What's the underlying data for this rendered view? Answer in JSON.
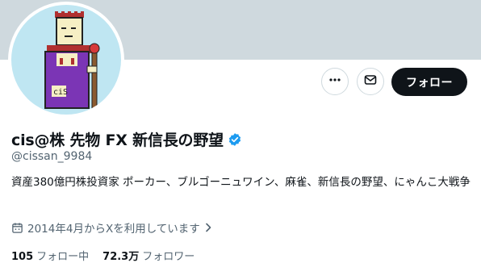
{
  "profile": {
    "display_name": "cis@株 先物 FX 新信長の野望",
    "handle": "@cissan_9984",
    "bio": "資産380億円株投資家 ポーカー、ブルゴーニュワイン、麻雀、新信長の野望、にゃんこ大戦争",
    "joined": "2014年4月からXを利用しています",
    "avatar_text": "ciS",
    "verified_icon": "verified-badge-icon"
  },
  "actions": {
    "more_icon": "more-icon",
    "message_icon": "mail-icon",
    "follow_label": "フォロー"
  },
  "stats": {
    "following_count": "105",
    "following_label": "フォロー中",
    "followers_count": "72.3万",
    "followers_label": "フォロワー"
  },
  "colors": {
    "banner": "#cfd9de",
    "avatar_bg": "#bfe6f2",
    "verified": "#1d9bf0",
    "follow_button": "#0f1419",
    "secondary_text": "#536471"
  }
}
